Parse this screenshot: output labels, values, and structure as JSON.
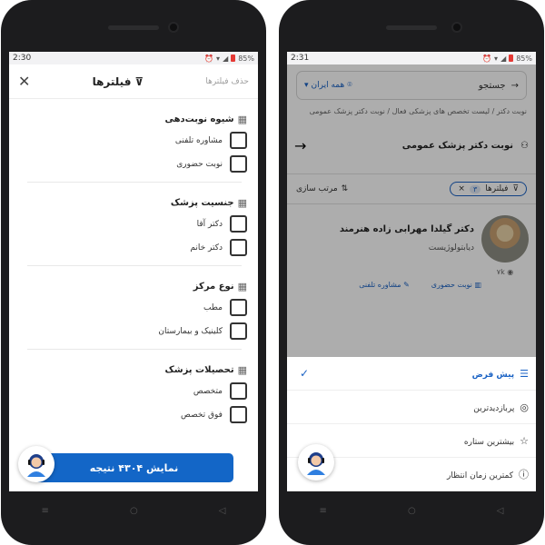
{
  "left": {
    "status": {
      "time": "2:30",
      "battery": "85%"
    },
    "header": {
      "clear_label": "حذف فیلترها",
      "title": "فیلترها"
    },
    "sections": [
      {
        "title": "شیوه نوبت‌دهی",
        "options": [
          "مشاوره تلفنی",
          "نوبت حضوری"
        ]
      },
      {
        "title": "جنسیت پزشک",
        "options": [
          "دکتر آقا",
          "دکتر خانم"
        ]
      },
      {
        "title": "نوع مرکز",
        "options": [
          "مطب",
          "کلینیک و بیمارستان"
        ]
      },
      {
        "title": "تحصیلات پزشک",
        "options": [
          "متخصص",
          "فوق تخصص"
        ]
      }
    ],
    "cta_label": "نمایش ۴۳۰۴ نتیجه"
  },
  "right": {
    "status": {
      "time": "2:31",
      "battery": "85%"
    },
    "search": {
      "placeholder": "جستجو",
      "location": "همه ایران"
    },
    "breadcrumb": "نوبت دکتر  /  لیست تخصص های پزشکی فعال  /  نوبت دکتر پزشک عمومی",
    "page_title": "نوبت دکتر پزشک عمومی",
    "filter_chip": {
      "label": "فیلترها",
      "count": "۳"
    },
    "sort_label": "مرتب سازی",
    "doctor": {
      "name": "دکتر گیلدا مهرابی زاده هنرمند",
      "specialty": "دیابتولوژیست",
      "views": "۷k",
      "action_in_person": "نوبت حضوری",
      "action_phone": "مشاوره تلفنی"
    },
    "sort_options": [
      "پیش فرض",
      "پربازدیدترین",
      "بیشترین ستاره",
      "کمترین زمان انتظار"
    ]
  },
  "colors": {
    "accent": "#1366c7",
    "dim_overlay": "rgba(0,0,0,0.32)"
  }
}
